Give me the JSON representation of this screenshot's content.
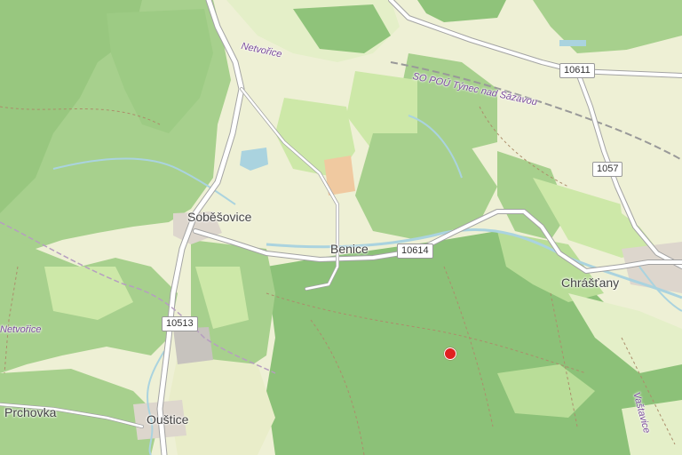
{
  "map": {
    "colors": {
      "forest": "#8cc178",
      "forest_dark": "#6fa85c",
      "meadow": "#cdebb0",
      "farmland": "#eef0d5",
      "road": "#ffffff",
      "road_casing": "#a3a3a3",
      "water": "#aad3df",
      "settlement": "#d9d0c9",
      "marker": "#e02020"
    },
    "labels": {
      "sobesovice": "Soběšovice",
      "benice": "Benice",
      "chrastany": "Chrášťany",
      "oustice": "Ouštice",
      "prchovka": "Prchovka",
      "netvorice_top": "Netvořice",
      "netvorice_left": "Netvořice",
      "vastavice": "Vaštavice",
      "rail": "SO POÚ Týnec nad Sázavou"
    },
    "shields": {
      "r10611": "10611",
      "r1057": "1057",
      "r10614": "10614",
      "r10513": "10513"
    },
    "marker_icon": "location-pin-icon"
  }
}
